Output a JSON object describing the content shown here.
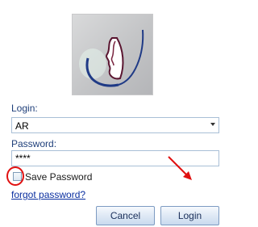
{
  "login": {
    "label": "Login:",
    "value": "AR"
  },
  "password": {
    "label": "Password:",
    "value": "****"
  },
  "save_password": {
    "label": "Save Password",
    "checked": false
  },
  "forgot_link": "forgot password?",
  "buttons": {
    "cancel": "Cancel",
    "login": "Login"
  },
  "icons": {
    "logo": "profile-silhouette-logo",
    "annotation_circle": "red-circle-annotation",
    "annotation_arrow": "red-arrow-annotation"
  },
  "colors": {
    "annotation": "#e01010",
    "link": "#0a2fa0",
    "label": "#1f3f7a"
  }
}
